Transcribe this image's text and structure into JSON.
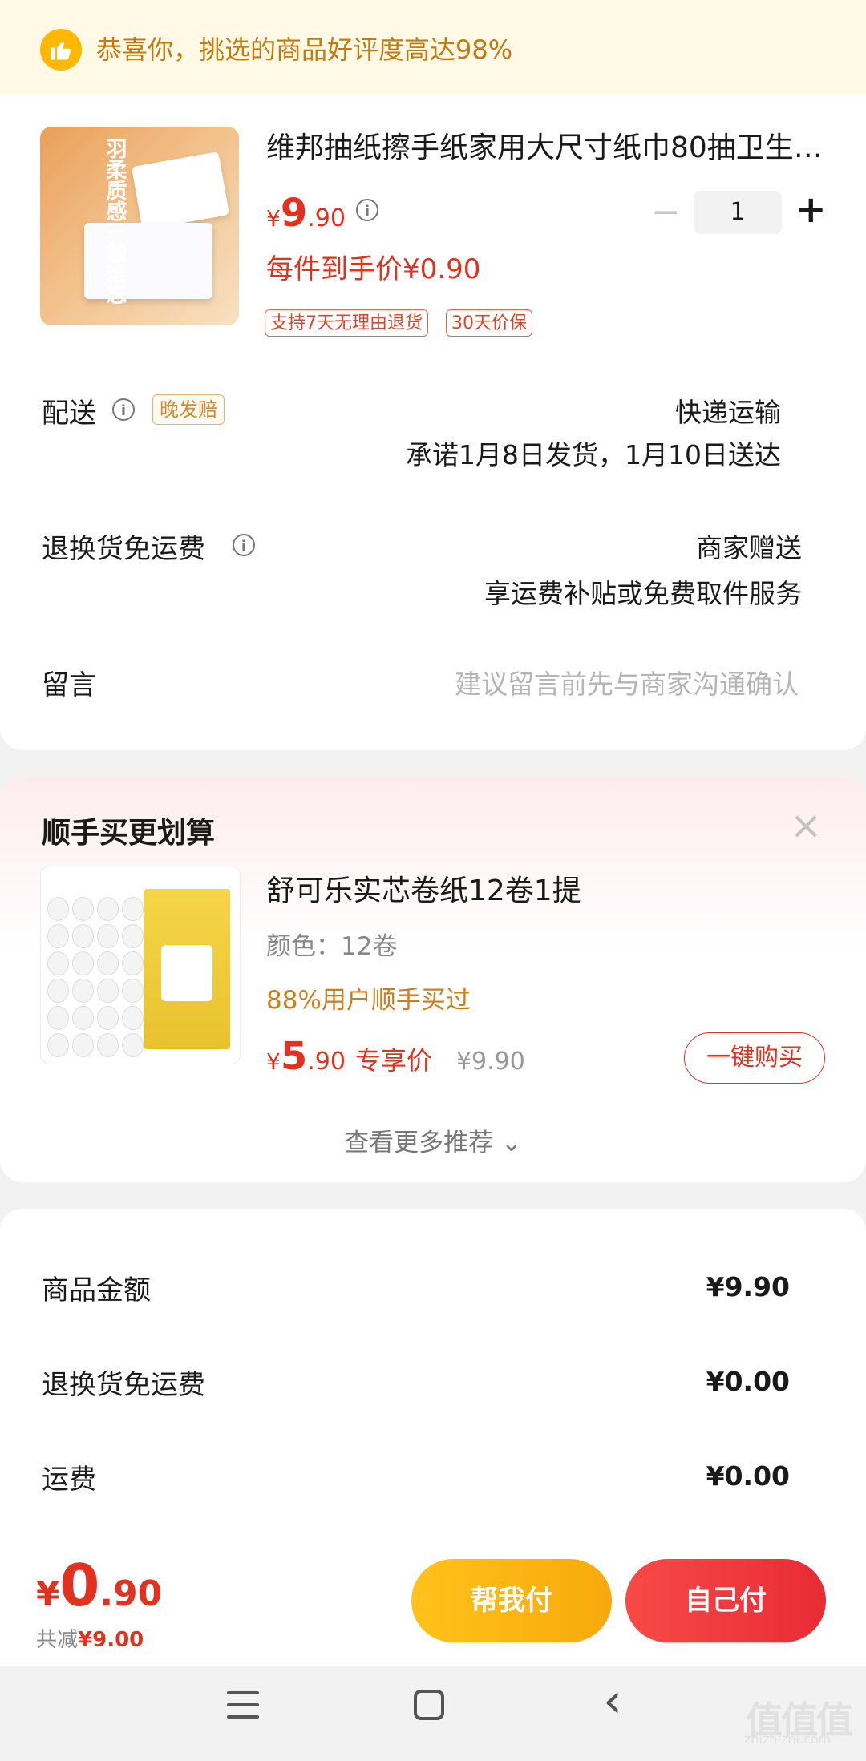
{
  "banner": {
    "icon": "thumbs-up-icon",
    "text": "恭喜你，挑选的商品好评度高达98%"
  },
  "product": {
    "image_text": "羽柔质感一触难忘",
    "title": "维邦抽纸擦手纸家用大尺寸纸巾80抽卫生…",
    "price_symbol": "¥",
    "price_int": "9",
    "price_dec": ".90",
    "quantity": "1",
    "minus": "−",
    "plus": "+",
    "unit_price": "每件到手价¥0.90",
    "tags": [
      "支持7天无理由退货",
      "30天价保"
    ]
  },
  "delivery": {
    "label": "配送",
    "badge": "晚发赔",
    "method": "快递运输",
    "promise": "承诺1月8日发货，1月10日送达"
  },
  "return_shipping": {
    "label": "退换货免运费",
    "value": "商家赠送",
    "desc": "享运费补贴或免费取件服务"
  },
  "message": {
    "label": "留言",
    "placeholder": "建议留言前先与商家沟通确认"
  },
  "addon": {
    "title": "顺手买更划算",
    "close": "×",
    "product_title": "舒可乐实芯卷纸12卷1提",
    "color": "颜色：12卷",
    "bought": "88%用户顺手买过",
    "price_symbol": "¥",
    "price_int": "5",
    "price_dec": ".90",
    "exclusive": "专享价",
    "original": "¥9.90",
    "buy_button": "一键购买",
    "more": "查看更多推荐 ⌄"
  },
  "summary": [
    {
      "label": "商品金额",
      "value": "¥9.90"
    },
    {
      "label": "退换货免运费",
      "value": "¥0.00"
    },
    {
      "label": "运费",
      "value": "¥0.00"
    }
  ],
  "footer": {
    "total_symbol": "¥",
    "total_int": "0",
    "total_dec": ".90",
    "saved_label": "共减",
    "saved_value": "¥9.00",
    "help_pay": "帮我付",
    "self_pay": "自己付"
  },
  "watermark": {
    "text": "值值值",
    "sub": "zhizhizhi.com"
  },
  "colors": {
    "accent": "#e0321f",
    "gold": "#ffb800",
    "banner_bg": "#fff9e6"
  }
}
